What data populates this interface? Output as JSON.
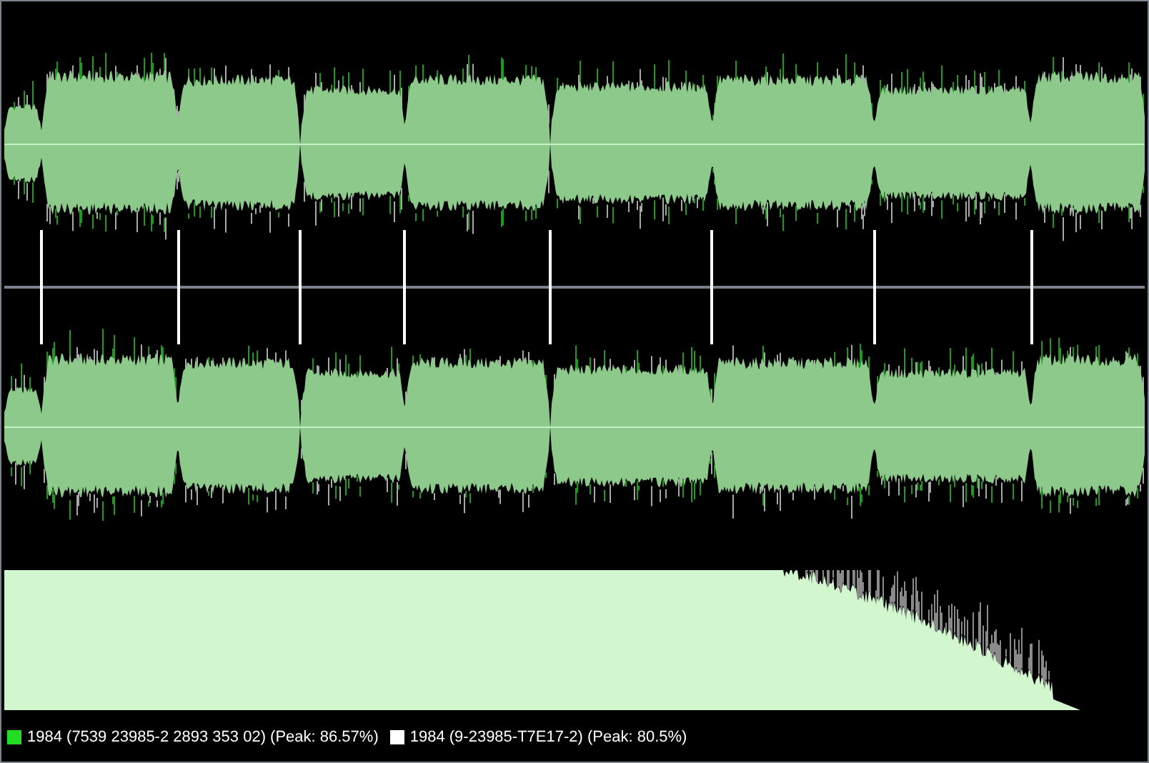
{
  "legend": [
    {
      "label": "1984 (7539 23985-2 2893 353 02) (Peak: 86.57%)",
      "color": "#22dd22"
    },
    {
      "label": "1984 (9-23985-T7E17-2) (Peak: 80.5%)",
      "color": "#ffffff"
    }
  ]
}
